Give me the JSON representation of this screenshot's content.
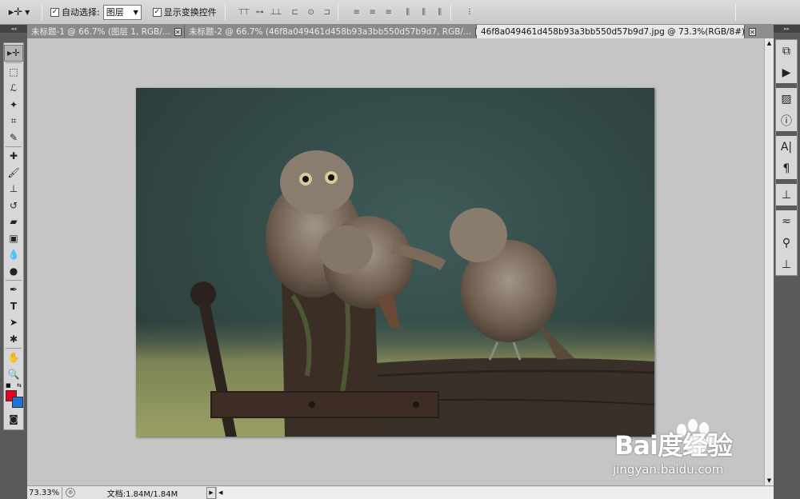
{
  "options_bar": {
    "tool_icon": "move-tool-icon",
    "auto_select_label": "自动选择:",
    "auto_select_checked": true,
    "auto_select_value": "图层",
    "show_transform_label": "显示变换控件",
    "show_transform_checked": true
  },
  "tabs": [
    {
      "label": "未标题-1 @ 66.7% (图层 1, RGB/...",
      "active": false
    },
    {
      "label": "未标题-2 @ 66.7% (46f8a049461d458b93a3bb550d57b9d7, RGB/...",
      "active": false
    },
    {
      "label": "46f8a049461d458b93a3bb550d57b9d7.jpg @ 73.3%(RGB/8#)",
      "active": true
    }
  ],
  "tools": [
    "move-tool-icon",
    "marquee-tool-icon",
    "lasso-tool-icon",
    "magic-wand-icon",
    "crop-tool-icon",
    "eyedropper-icon",
    "healing-brush-icon",
    "brush-tool-icon",
    "clone-stamp-icon",
    "history-brush-icon",
    "eraser-icon",
    "gradient-tool-icon",
    "blur-tool-icon",
    "dodge-tool-icon",
    "pen-tool-icon",
    "type-tool-icon",
    "path-selection-icon",
    "shape-tool-icon",
    "hand-tool-icon",
    "zoom-tool-icon"
  ],
  "colors": {
    "foreground": "#e8001c",
    "background": "#1e73d6"
  },
  "dock": [
    "layers-panel-icon",
    "actions-panel-icon",
    "navigator-panel-icon",
    "info-panel-icon",
    "character-panel-icon",
    "paragraph-panel-icon",
    "clone-source-icon",
    "brushes-panel-icon",
    "tool-presets-icon",
    "swatches-panel-icon"
  ],
  "status": {
    "zoom": "73.33%",
    "doc_info": "文档:1.84M/1.84M"
  },
  "watermark": {
    "logo": "Bai度经验",
    "url": "jingyan.baidu.com"
  }
}
